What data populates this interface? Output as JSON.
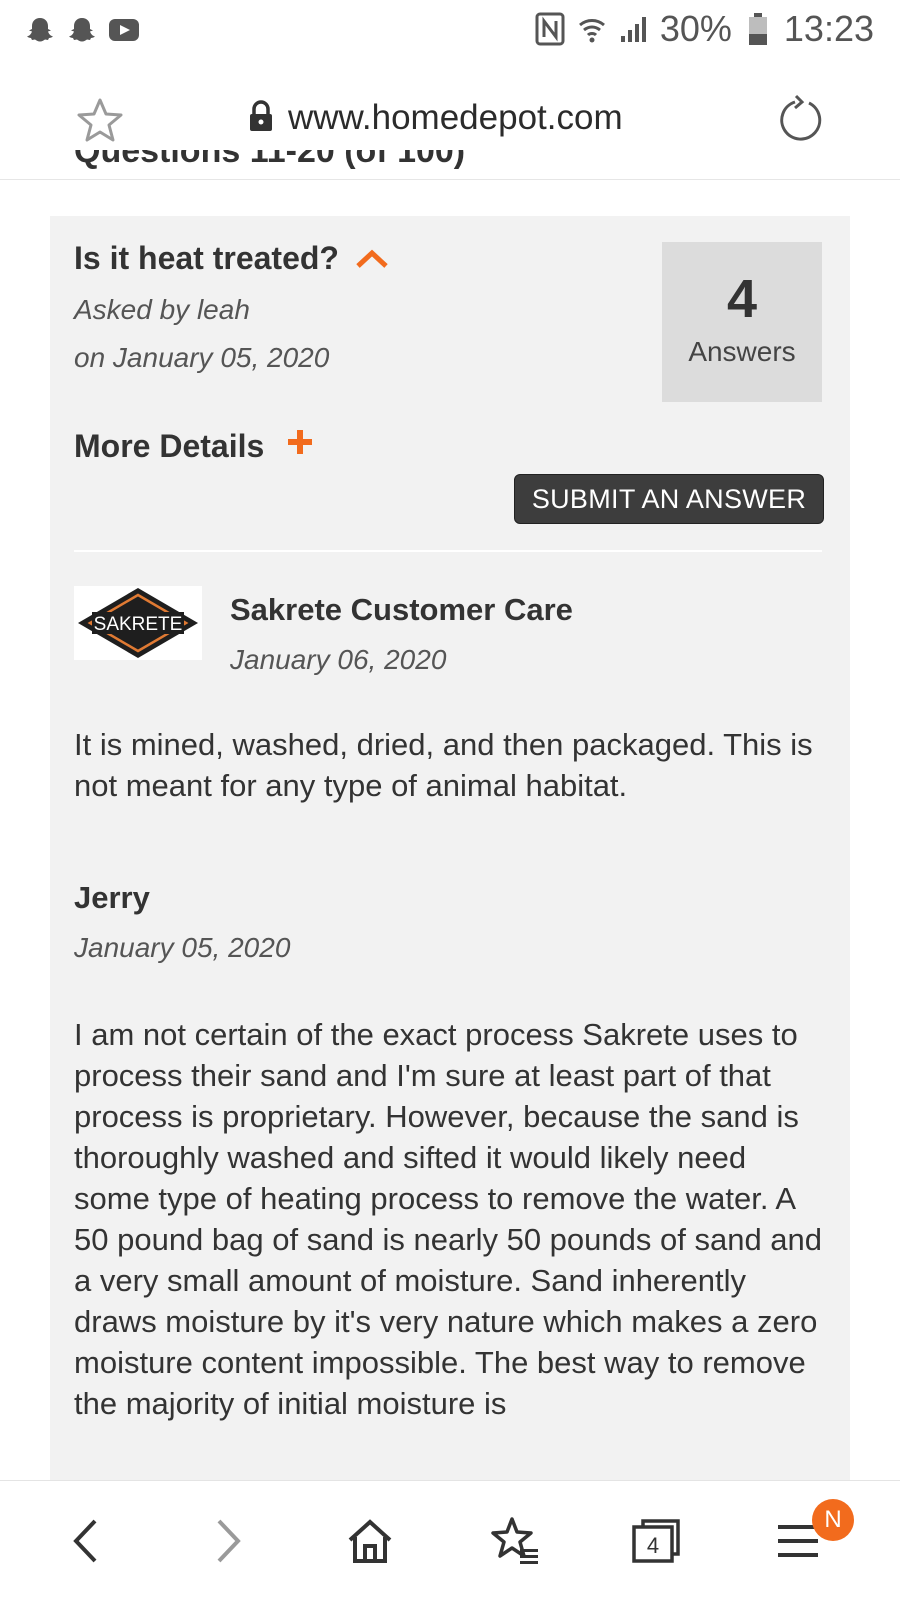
{
  "status_bar": {
    "left_icons": [
      "snapchat-icon",
      "snapchat-icon",
      "youtube-icon"
    ],
    "right_icons": [
      "nfc-icon",
      "wifi-icon",
      "signal-icon"
    ],
    "battery": "30%",
    "time": "13:23"
  },
  "browser": {
    "url": "www.homedepot.com",
    "star_icon": "star-icon",
    "lock_icon": "lock-icon",
    "reload_icon": "reload-icon"
  },
  "page": {
    "partial_heading": "Questions 11-20 (of 100)",
    "question": {
      "title": "Is it heat treated?",
      "asked_by": "Asked by leah",
      "asked_on": "on January 05, 2020",
      "answers_count": "4",
      "answers_label": "Answers",
      "more_details": "More Details",
      "submit_label": "SUBMIT AN ANSWER"
    },
    "answers": [
      {
        "author": "Sakrete Customer Care",
        "logo_text": "SAKRETE",
        "date": "January 06, 2020",
        "body": "It is mined, washed, dried, and then packaged. This is not meant for any type of animal habitat."
      },
      {
        "author": "Jerry",
        "date": "January 05, 2020",
        "body": "I am not certain of the exact process Sakrete uses to process their sand and I'm sure at least part of that process is proprietary. However, because the sand is thoroughly washed and sifted it would likely need some type of heating process to remove the water. A 50 pound bag of sand is nearly 50 pounds of sand and a very small amount of moisture. Sand inherently draws moisture by it's very nature which makes a zero moisture content impossible. The best way to remove the majority of initial moisture is"
      }
    ]
  },
  "bottom_nav": {
    "items": [
      "back-icon",
      "forward-icon",
      "home-icon",
      "bookmarks-icon",
      "tabs-icon",
      "menu-icon"
    ],
    "tabs_count": "4",
    "menu_badge": "N"
  },
  "colors": {
    "accent": "#f26b1d",
    "panel_bg": "#f2f2f2",
    "answers_box_bg": "#dcdcdc",
    "button_bg": "#3d3d3d"
  }
}
